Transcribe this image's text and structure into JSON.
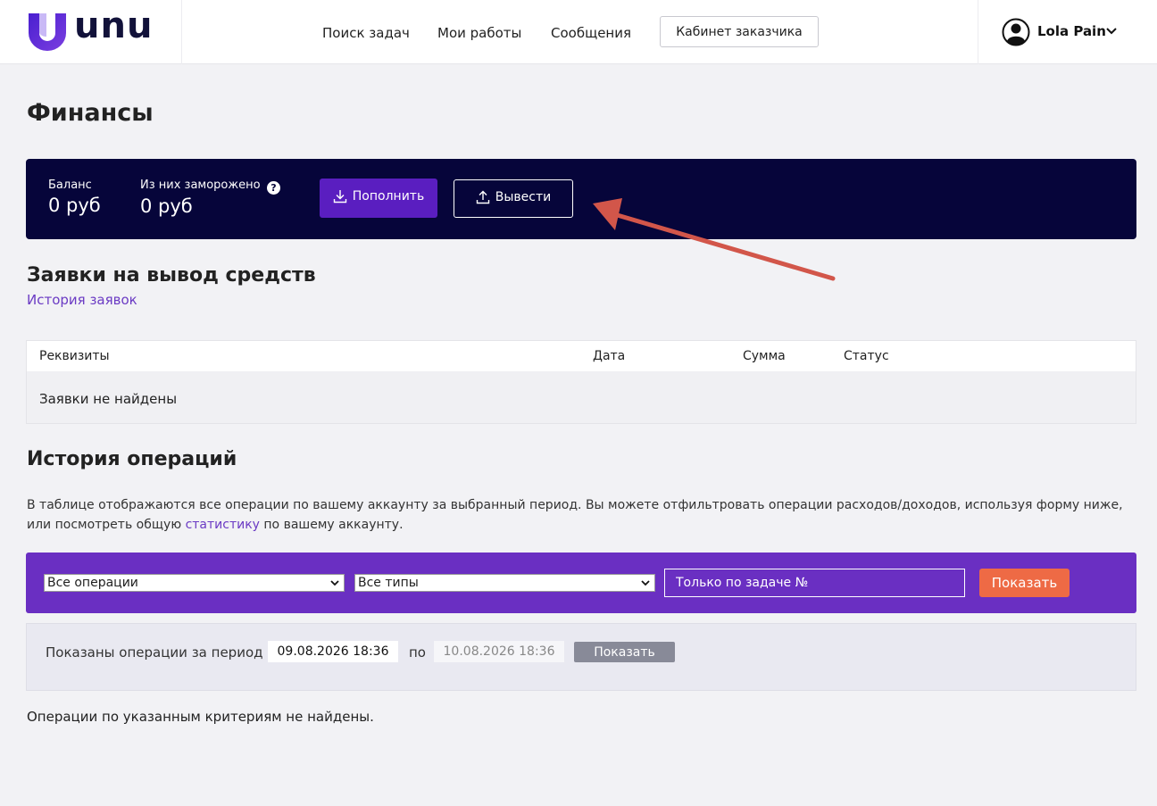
{
  "header": {
    "logo_text": "unu",
    "nav": [
      "Поиск задач",
      "Мои работы",
      "Сообщения"
    ],
    "cabinet_button": "Кабинет заказчика",
    "user_name": "Lola Pain"
  },
  "page_title": "Финансы",
  "balance": {
    "balance_label": "Баланс",
    "balance_value": "0 руб",
    "frozen_label": "Из них заморожено",
    "frozen_value": "0 руб",
    "topup_label": "Пополнить",
    "withdraw_label": "Вывести"
  },
  "requests": {
    "title": "Заявки на вывод средств",
    "history_link": "История заявок",
    "columns": [
      "Реквизиты",
      "Дата",
      "Сумма",
      "Статус"
    ],
    "empty": "Заявки не найдены"
  },
  "operations": {
    "title": "История операций",
    "desc_1": "В таблице отображаются все операции по вашему аккаунту за выбранный период. Вы можете отфильтровать операции расходов/доходов, используя форму ниже, или посмотреть общую ",
    "desc_link": "статистику",
    "desc_2": " по вашему аккаунту.",
    "filter_ops": "Все операции",
    "filter_types": "Все типы",
    "task_placeholder": "Только по задаче №",
    "show_button": "Показать",
    "period_label": "Показаны операции за период с",
    "period_from": "09.08.2026 18:36",
    "period_to_label": "по",
    "period_to": "10.08.2026 18:36",
    "period_show_button": "Показать",
    "empty": "Операции по указанным критериям не найдены."
  },
  "colors": {
    "brand_purple": "#6a2fc2",
    "dark_navy": "#06053a",
    "accent_orange": "#ee6a45",
    "annotation_arrow": "#d2564a"
  }
}
